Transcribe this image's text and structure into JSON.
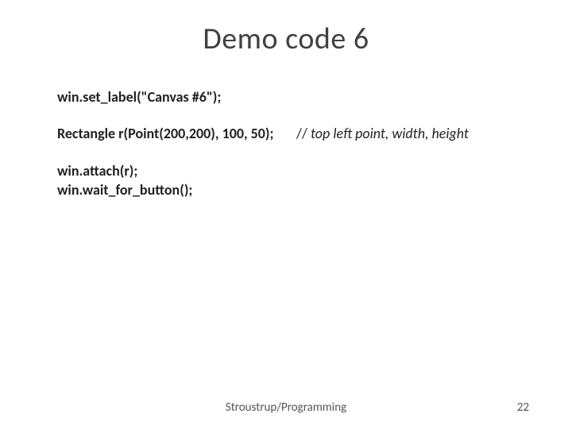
{
  "title": "Demo code 6",
  "lines": {
    "l1_code": "win.set_label(\"Canvas #6\");",
    "l2_code": "Rectangle r(Point(200,200), 100, 50);",
    "l2_comment_prefix": "// ",
    "l2_comment_text": "top left point, width, height",
    "l3_code": "win.attach(r);",
    "l4_code": "win.wait_for_button();"
  },
  "footer": "Stroustrup/Programming",
  "page_number": "22"
}
